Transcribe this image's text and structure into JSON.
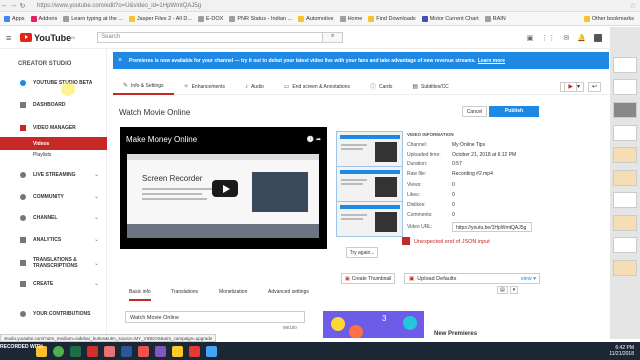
{
  "browser": {
    "url": "https://www.youtube.com/edit?o=U&video_id=1HpWmtQAJ5g",
    "bookmarks": [
      {
        "label": "Apps",
        "color": "#4285f4"
      },
      {
        "label": "Addons",
        "color": "#e91e63"
      },
      {
        "label": "Learn typing at the ...",
        "color": "#9e9e9e"
      },
      {
        "label": "Jasper Files 2 - All D...",
        "color": "#fbc02d"
      },
      {
        "label": "E-DOX",
        "color": "#9e9e9e"
      },
      {
        "label": "PNR Status - Indian ...",
        "color": "#9e9e9e"
      },
      {
        "label": "Automotive",
        "color": "#fbc02d"
      },
      {
        "label": "Home",
        "color": "#9e9e9e"
      },
      {
        "label": "Find Downloads",
        "color": "#fbc02d"
      },
      {
        "label": "Motor Current Chart",
        "color": "#3f51b5"
      },
      {
        "label": "RAIN",
        "color": "#9e9e9e"
      }
    ],
    "other_bookmarks": "Other bookmarks"
  },
  "youtube": {
    "logo": "YouTube",
    "logo_sup": "IN",
    "search_placeholder": "Search"
  },
  "sidebar": {
    "heading": "CREATOR STUDIO",
    "items": [
      {
        "label": "YOUTUBE STUDIO BETA",
        "icon": "gear-icon",
        "color": "#1e88e5"
      },
      {
        "label": "DASHBOARD",
        "icon": "dashboard-icon",
        "color": "#777"
      },
      {
        "label": "VIDEO MANAGER",
        "icon": "video-manager-icon",
        "color": "#c62828"
      },
      {
        "label": "Videos",
        "active": true
      },
      {
        "label": "Playlists"
      },
      {
        "label": "LIVE STREAMING",
        "icon": "live-icon",
        "color": "#777"
      },
      {
        "label": "COMMUNITY",
        "icon": "community-icon",
        "color": "#777"
      },
      {
        "label": "CHANNEL",
        "icon": "channel-icon",
        "color": "#777"
      },
      {
        "label": "ANALYTICS",
        "icon": "analytics-icon",
        "color": "#777"
      },
      {
        "label": "TRANSLATIONS & TRANSCRIPTIONS",
        "icon": "translate-icon",
        "color": "#777"
      },
      {
        "label": "CREATE",
        "icon": "create-icon",
        "color": "#777"
      },
      {
        "label": "YOUR CONTRIBUTIONS",
        "icon": "contributions-icon",
        "color": "#777"
      }
    ]
  },
  "banner": {
    "text": "Premieres is now available for your channel — try it out to debut your latest video live with your fans and take advantage of new revenue streams.",
    "link": "Learn more"
  },
  "tabs": [
    "Info & Settings",
    "Enhancements",
    "Audio",
    "End screen & Annotations",
    "Cards",
    "Subtitles/CC"
  ],
  "editor": {
    "title": "Watch Movie Online",
    "cancel_label": "Cancel",
    "publish_label": "Publish",
    "video_title": "Make Money Online",
    "preview_heading": "Screen Recorder",
    "try_again_label": "Try again...",
    "create_thumbnail_label": "Create Thumbnail",
    "upload_defaults_label": "Upload Defaults",
    "view_label": "view"
  },
  "video_info": {
    "heading": "VIDEO INFORMATION",
    "rows": [
      {
        "label": "Channel:",
        "value": "My Online Tips"
      },
      {
        "label": "Uploaded time:",
        "value": "October 21, 2018 at 6:12 PM"
      },
      {
        "label": "Duration:",
        "value": "0:57"
      },
      {
        "label": "Raw file:",
        "value": "Recording #2.mp4"
      },
      {
        "label": "Views:",
        "value": "0"
      },
      {
        "label": "Likes:",
        "value": "0"
      },
      {
        "label": "Dislikes:",
        "value": "0"
      },
      {
        "label": "Comments:",
        "value": "0"
      },
      {
        "label": "Video URL:",
        "value": "https://youtu.be/1HpWmtQAJ5g"
      }
    ],
    "error": "Unexpected end of JSON input"
  },
  "lower_tabs": [
    "Basic info",
    "Translations",
    "Monetization",
    "Advanced settings"
  ],
  "basic_info": {
    "title_value": "Watch Movie Online",
    "char_count": "98/100"
  },
  "promo": {
    "number": "3",
    "heading": "New Premieres"
  },
  "status_bar": "studio.youtube.com/?utm_medium=sidebar_button&utm_source=MY_VIDEOS&utm_campaign=upgrade",
  "taskbar": {
    "rec_label": "RECORDED WITH",
    "time": "6:42 PM",
    "date": "11/21/2018"
  }
}
